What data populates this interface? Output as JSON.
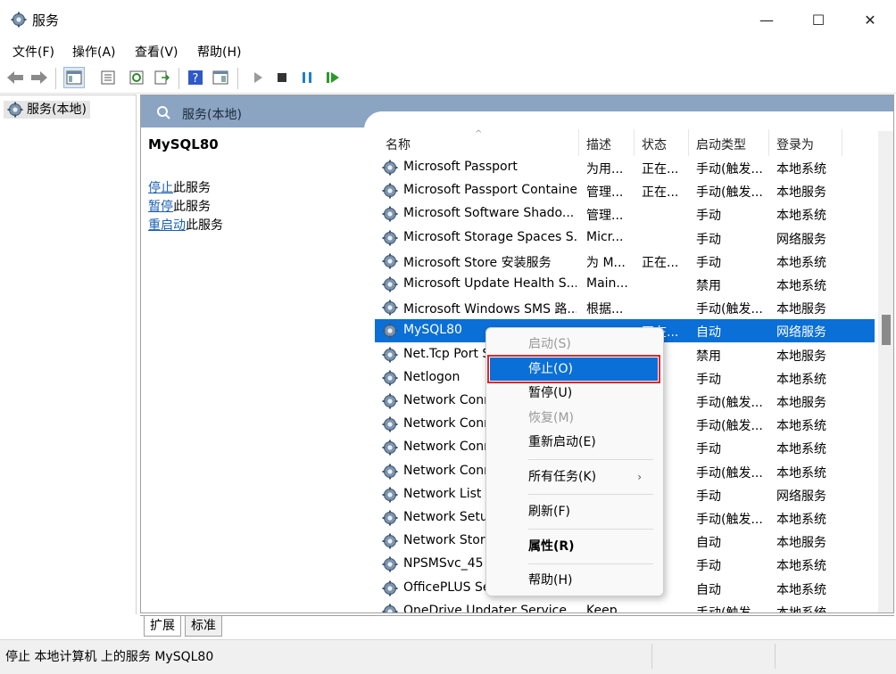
{
  "window": {
    "title": "服务",
    "minimize": "—",
    "maximize": "☐",
    "close": "✕"
  },
  "menu": [
    "文件(F)",
    "操作(A)",
    "查看(V)",
    "帮助(H)"
  ],
  "tree": {
    "root": "服务(本地)"
  },
  "pane": {
    "title": "服务(本地)"
  },
  "details": {
    "service_name": "MySQL80",
    "stop_link": "停止",
    "stop_suffix": "此服务",
    "pause_link": "暂停",
    "pause_suffix": "此服务",
    "restart_link": "重启动",
    "restart_suffix": "此服务"
  },
  "columns": {
    "name": "名称",
    "desc": "描述",
    "status": "状态",
    "startup": "启动类型",
    "logon": "登录为"
  },
  "rows": [
    {
      "name": "Microsoft Passport",
      "desc": "为用...",
      "status": "正在...",
      "startup": "手动(触发...",
      "logon": "本地系统"
    },
    {
      "name": "Microsoft Passport Container",
      "desc": "管理...",
      "status": "正在...",
      "startup": "手动(触发...",
      "logon": "本地服务"
    },
    {
      "name": "Microsoft Software Shado...",
      "desc": "管理...",
      "status": "",
      "startup": "手动",
      "logon": "本地系统"
    },
    {
      "name": "Microsoft Storage Spaces S...",
      "desc": "Micr...",
      "status": "",
      "startup": "手动",
      "logon": "网络服务"
    },
    {
      "name": "Microsoft Store 安装服务",
      "desc": "为 M...",
      "status": "正在...",
      "startup": "手动",
      "logon": "本地系统"
    },
    {
      "name": "Microsoft Update Health S...",
      "desc": "Main...",
      "status": "",
      "startup": "禁用",
      "logon": "本地系统"
    },
    {
      "name": "Microsoft Windows SMS 路...",
      "desc": "根据...",
      "status": "",
      "startup": "手动(触发...",
      "logon": "本地服务"
    },
    {
      "name": "MySQL80",
      "desc": "",
      "status": "正在...",
      "startup": "自动",
      "logon": "网络服务"
    },
    {
      "name": "Net.Tcp Port S",
      "desc": "",
      "status": "",
      "startup": "禁用",
      "logon": "本地服务"
    },
    {
      "name": "Netlogon",
      "desc": "",
      "status": "",
      "startup": "手动",
      "logon": "本地系统"
    },
    {
      "name": "Network Conn",
      "desc": "",
      "status": "",
      "startup": "手动(触发...",
      "logon": "本地服务"
    },
    {
      "name": "Network Conn",
      "desc": "",
      "status": "E...",
      "startup": "手动(触发...",
      "logon": "本地系统"
    },
    {
      "name": "Network Conn",
      "desc": "",
      "status": "E...",
      "startup": "手动",
      "logon": "本地系统"
    },
    {
      "name": "Network Conn",
      "desc": "",
      "status": "",
      "startup": "手动(触发...",
      "logon": "本地系统"
    },
    {
      "name": "Network List S",
      "desc": "",
      "status": "E...",
      "startup": "手动",
      "logon": "网络服务"
    },
    {
      "name": "Network Setu",
      "desc": "",
      "status": "",
      "startup": "手动(触发...",
      "logon": "本地系统"
    },
    {
      "name": "Network Store",
      "desc": "",
      "status": "E...",
      "startup": "自动",
      "logon": "本地服务"
    },
    {
      "name": "NPSMSvc_45",
      "desc": "",
      "status": "E...",
      "startup": "手动",
      "logon": "本地系统"
    },
    {
      "name": "OfficePLUS Se",
      "desc": "",
      "status": "E...",
      "startup": "自动",
      "logon": "本地系统"
    },
    {
      "name": "OneDrive Updater Service",
      "desc": "Keep...",
      "status": "",
      "startup": "手动(触发...",
      "logon": "本地系统"
    }
  ],
  "context_menu": {
    "start": "启动(S)",
    "stop": "停止(O)",
    "pause": "暂停(U)",
    "resume": "恢复(M)",
    "restart": "重新启动(E)",
    "all_tasks": "所有任务(K)",
    "refresh": "刷新(F)",
    "properties": "属性(R)",
    "help": "帮助(H)",
    "submenu_arrow": "›"
  },
  "tabs": {
    "extended": "扩展",
    "standard": "标准"
  },
  "status": {
    "text": "停止 本地计算机 上的服务 MySQL80"
  },
  "colors": {
    "selection": "#0a6fd6",
    "header": "#8aa4c2",
    "highlight_border": "#e0262a"
  }
}
